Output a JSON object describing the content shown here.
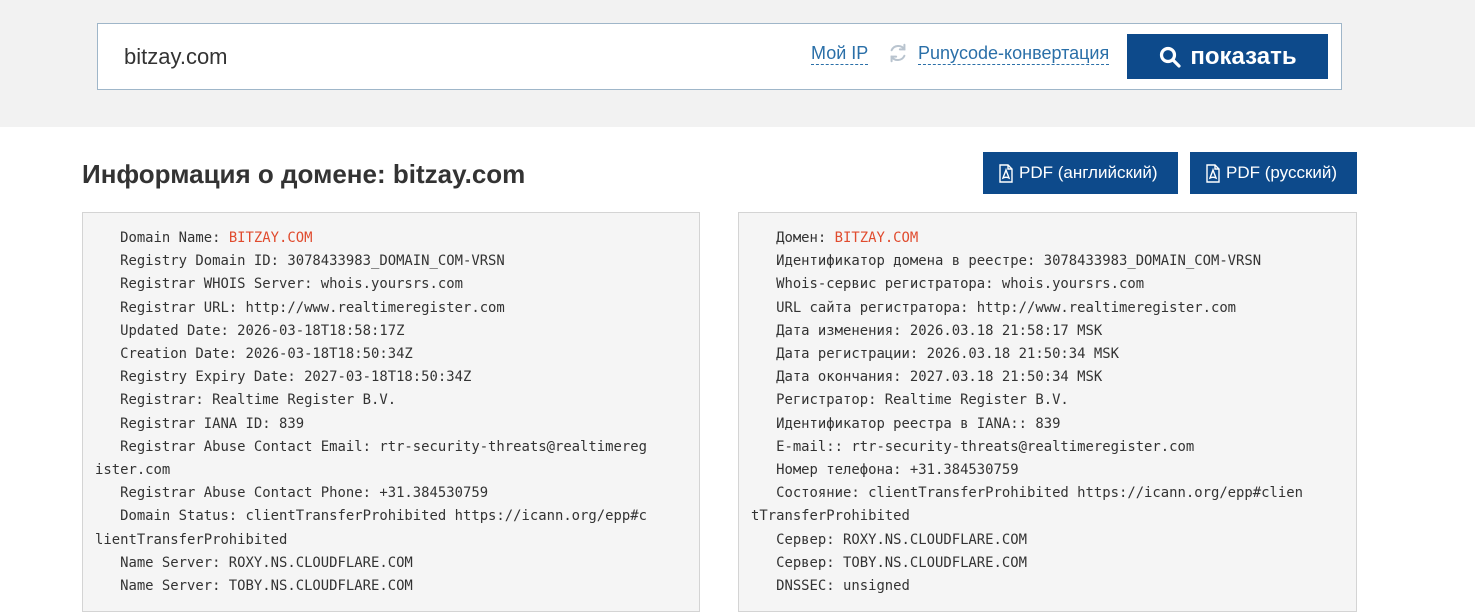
{
  "search": {
    "value": "bitzay.com",
    "my_ip_label": "Мой IP",
    "punycode_label": "Punycode-конвертация",
    "show_label": "показать"
  },
  "header": {
    "title_prefix": "Информация о домене:",
    "title_domain": "bitzay.com",
    "pdf_en_label": "PDF (английский)",
    "pdf_ru_label": "PDF (русский)"
  },
  "whois_en": [
    {
      "indent": "   ",
      "text": "Domain Name: ",
      "value": "BITZAY.COM"
    },
    {
      "indent": "   ",
      "text": "Registry Domain ID: 3078433983_DOMAIN_COM-VRSN"
    },
    {
      "indent": "   ",
      "text": "Registrar WHOIS Server: whois.yoursrs.com"
    },
    {
      "indent": "   ",
      "text": "Registrar URL: http://www.realtimeregister.com"
    },
    {
      "indent": "   ",
      "text": "Updated Date: 2026-03-18T18:58:17Z"
    },
    {
      "indent": "   ",
      "text": "Creation Date: 2026-03-18T18:50:34Z"
    },
    {
      "indent": "   ",
      "text": "Registry Expiry Date: 2027-03-18T18:50:34Z"
    },
    {
      "indent": "   ",
      "text": "Registrar: Realtime Register B.V."
    },
    {
      "indent": "   ",
      "text": "Registrar IANA ID: 839"
    },
    {
      "indent": "   ",
      "text": "Registrar Abuse Contact Email: rtr-security-threats@realtimereg"
    },
    {
      "indent": "",
      "text": "ister.com"
    },
    {
      "indent": "   ",
      "text": "Registrar Abuse Contact Phone: +31.384530759"
    },
    {
      "indent": "   ",
      "text": "Domain Status: clientTransferProhibited https://icann.org/epp#c"
    },
    {
      "indent": "",
      "text": "lientTransferProhibited"
    },
    {
      "indent": "   ",
      "text": "Name Server: ROXY.NS.CLOUDFLARE.COM"
    },
    {
      "indent": "   ",
      "text": "Name Server: TOBY.NS.CLOUDFLARE.COM"
    }
  ],
  "whois_ru": [
    {
      "indent": "   ",
      "text": "Домен: ",
      "value": "BITZAY.COM"
    },
    {
      "indent": "   ",
      "text": "Идентификатор домена в реестре: 3078433983_DOMAIN_COM-VRSN"
    },
    {
      "indent": "   ",
      "text": "Whois-сервис регистратора: whois.yoursrs.com"
    },
    {
      "indent": "   ",
      "text": "URL сайта регистратора: http://www.realtimeregister.com"
    },
    {
      "indent": "   ",
      "text": "Дата изменения: 2026.03.18 21:58:17 MSK"
    },
    {
      "indent": "   ",
      "text": "Дата регистрации: 2026.03.18 21:50:34 MSK"
    },
    {
      "indent": "   ",
      "text": "Дата окончания: 2027.03.18 21:50:34 MSK"
    },
    {
      "indent": "   ",
      "text": "Регистратор: Realtime Register B.V."
    },
    {
      "indent": "   ",
      "text": "Идентификатор реестра в IANA:: 839"
    },
    {
      "indent": "   ",
      "text": "E-mail:: rtr-security-threats@realtimeregister.com"
    },
    {
      "indent": "   ",
      "text": "Номер телефона: +31.384530759"
    },
    {
      "indent": "   ",
      "text": "Состояние: clientTransferProhibited https://icann.org/epp#clien"
    },
    {
      "indent": "",
      "text": "tTransferProhibited"
    },
    {
      "indent": "   ",
      "text": "Сервер: ROXY.NS.CLOUDFLARE.COM"
    },
    {
      "indent": "   ",
      "text": "Сервер: TOBY.NS.CLOUDFLARE.COM"
    },
    {
      "indent": "   ",
      "text": "DNSSEC: unsigned"
    }
  ]
}
